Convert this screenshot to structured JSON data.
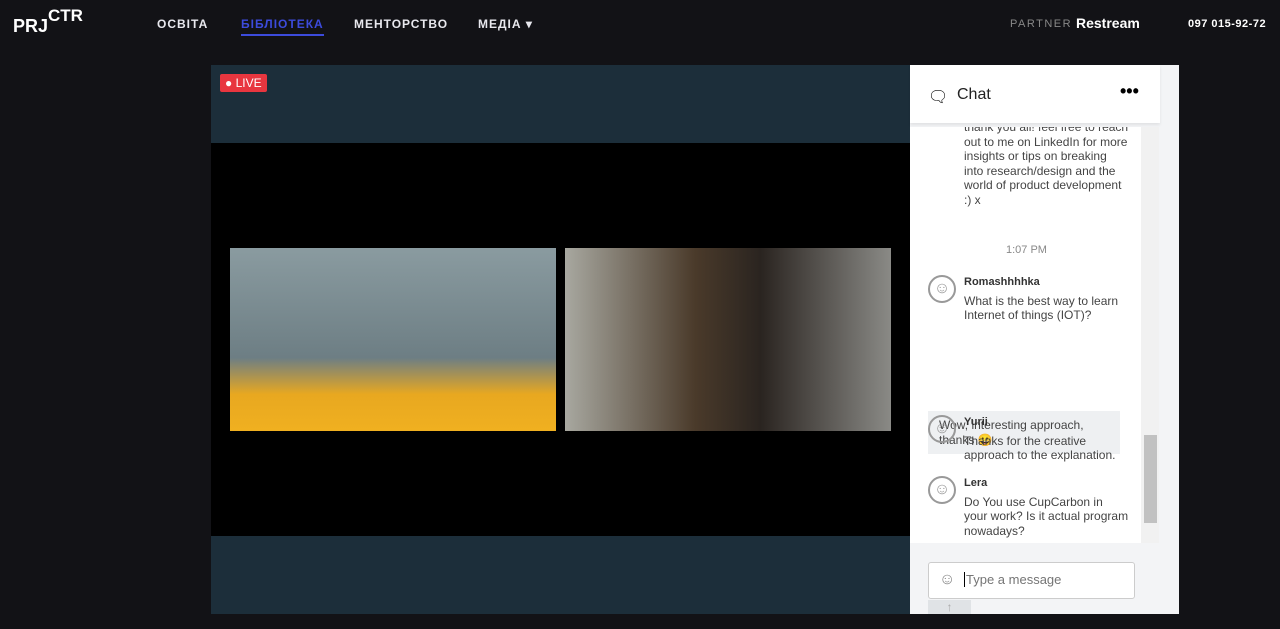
{
  "nav": {
    "logo": "PRJCTR",
    "items": [
      {
        "label": "ОСВІТА"
      },
      {
        "label": "БІБЛІОТЕКА",
        "active": true
      },
      {
        "label": "МЕНТОРСТВО"
      },
      {
        "label": "МЕДІА ▾"
      }
    ],
    "partner": "PARTNER",
    "partner_name": "Restream",
    "phone": "097 015-92-72"
  },
  "player": {
    "live": "● LIVE"
  },
  "chat": {
    "title": "Chat",
    "more": "•••",
    "partial_message": "thank you all! feel free to reach out to me on LinkedIn for more insights or tips on breaking into research/design and the world of product development :) x",
    "time": "1:07 PM",
    "messages": [
      {
        "name": "Romashhhhka",
        "text": "What is the best way to learn Internet of things (IOT)?"
      },
      {
        "name": "Yurii",
        "text": "Thanks for the creative approach to the explanation."
      },
      {
        "name": "Lera",
        "text": "Do You use CupCarbon in your work? Is it actual program nowadays?"
      }
    ],
    "own_message": "Wow, interesting approach, thanks 😀",
    "input_placeholder": "Type a message",
    "send": "↑"
  }
}
